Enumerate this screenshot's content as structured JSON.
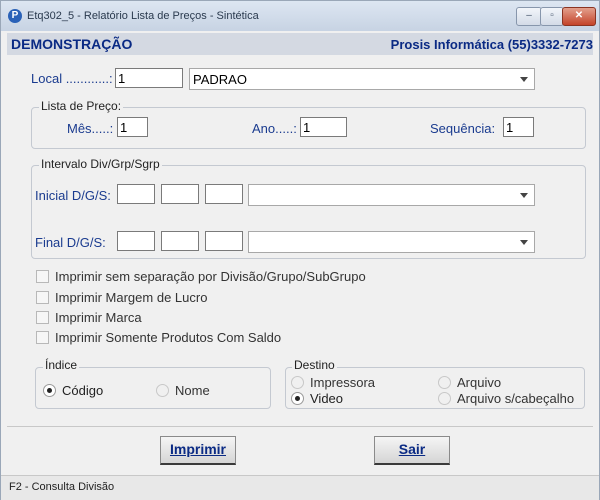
{
  "window": {
    "title": "Etq302_5 - Relatório Lista de Preços - Sintética",
    "minimize_glyph": "–",
    "maximize_glyph": "▫",
    "close_glyph": "✕"
  },
  "banner": {
    "left": "DEMONSTRAÇÃO",
    "right": "Prosis Informática (55)3332-7273"
  },
  "local": {
    "label": "Local ............:",
    "code": "1",
    "name": "PADRAO"
  },
  "lista_preco": {
    "legend": "Lista de Preço:",
    "mes_label": "Mês.....:",
    "mes": "1",
    "ano_label": "Ano.....:",
    "ano": "1",
    "seq_label": "Sequência:",
    "seq": "1"
  },
  "intervalo": {
    "legend": "Intervalo Div/Grp/Sgrp",
    "inicial_label": "Inicial  D/G/S:",
    "final_label": "Final  D/G/S:",
    "inicial": {
      "d": "",
      "g": "",
      "s": "",
      "descricao": ""
    },
    "final": {
      "d": "",
      "g": "",
      "s": "",
      "descricao": ""
    }
  },
  "options": [
    "Imprimir sem separação por Divisão/Grupo/SubGrupo",
    "Imprimir Margem de Lucro",
    "Imprimir Marca",
    "Imprimir Somente Produtos Com Saldo"
  ],
  "indice": {
    "legend": "Índice",
    "codigo": "Código",
    "nome": "Nome",
    "selected": "codigo"
  },
  "destino": {
    "legend": "Destino",
    "impressora": "Impressora",
    "arquivo": "Arquivo",
    "video": "Video",
    "arquivo_cab": "Arquivo s/cabeçalho",
    "selected": "video"
  },
  "buttons": {
    "imprimir": "Imprimir",
    "sair": "Sair"
  },
  "status": "F2 - Consulta Divisão",
  "colors": {
    "label_blue": "#1a3b8f",
    "banner_text": "#0a2a84",
    "banner_bg": "#d4d9e2"
  }
}
